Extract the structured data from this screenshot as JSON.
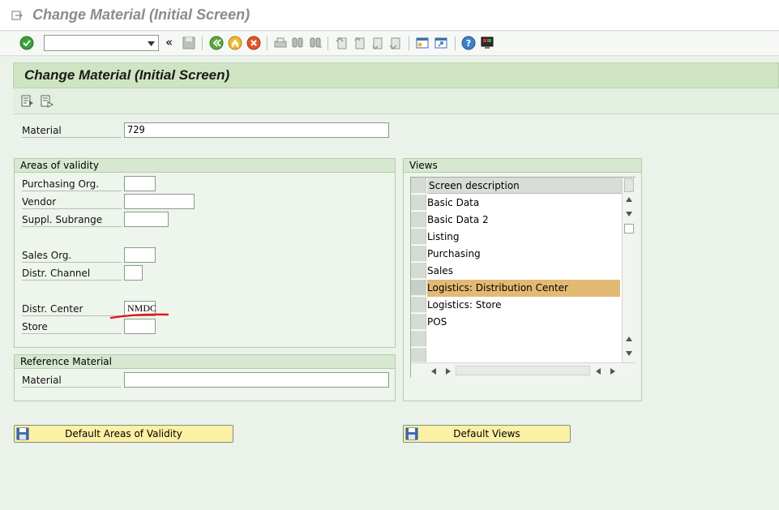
{
  "window": {
    "title": "Change Material (Initial Screen)"
  },
  "screen": {
    "title": "Change Material (Initial Screen)"
  },
  "colors": {
    "selected_row": "#e3ba74",
    "button_yellow": "#fcf0a4",
    "title_band": "#cfe4c3"
  },
  "material": {
    "label": "Material",
    "value": "729"
  },
  "areas": {
    "header": "Areas of validity",
    "purchasing_org": {
      "label": "Purchasing Org.",
      "value": ""
    },
    "vendor": {
      "label": "Vendor",
      "value": ""
    },
    "suppl_subrange": {
      "label": "Suppl. Subrange",
      "value": ""
    },
    "sales_org": {
      "label": "Sales Org.",
      "value": ""
    },
    "distr_channel": {
      "label": "Distr. Channel",
      "value": ""
    },
    "distr_center": {
      "label": "Distr. Center",
      "value": "NMDC"
    },
    "store": {
      "label": "Store",
      "value": ""
    }
  },
  "reference": {
    "header": "Reference Material",
    "material": {
      "label": "Material",
      "value": ""
    }
  },
  "views": {
    "header": "Views",
    "column_header": "Screen description",
    "rows": [
      {
        "label": "Basic Data",
        "selected": false
      },
      {
        "label": "Basic Data 2",
        "selected": false
      },
      {
        "label": "Listing",
        "selected": false
      },
      {
        "label": "Purchasing",
        "selected": false
      },
      {
        "label": "Sales",
        "selected": false
      },
      {
        "label": "Logistics: Distribution Center",
        "selected": true
      },
      {
        "label": "Logistics: Store",
        "selected": false
      },
      {
        "label": "POS",
        "selected": false
      }
    ]
  },
  "buttons": {
    "default_areas": "Default Areas of Validity",
    "default_views": "Default Views"
  },
  "icons": [
    "menu-icon",
    "check-icon",
    "back-icon",
    "save-icon",
    "green-back-icon",
    "exit-icon",
    "cancel-icon",
    "print-icon",
    "find-icon",
    "find-next-icon",
    "first-page-icon",
    "prev-page-icon",
    "next-page-icon",
    "last-page-icon",
    "new-session-icon",
    "shortcut-icon",
    "help-icon",
    "customize-icon",
    "select-views-icon",
    "org-levels-icon"
  ]
}
